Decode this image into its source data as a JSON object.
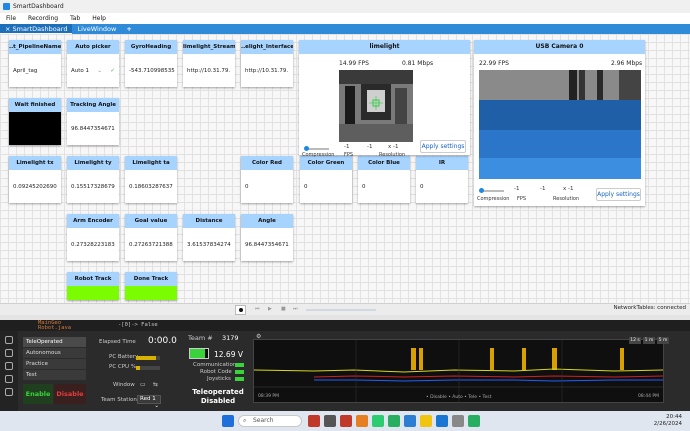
{
  "window": {
    "title": "SmartDashboard"
  },
  "menu": [
    "File",
    "Recording",
    "Tab",
    "Help"
  ],
  "tabs": [
    {
      "label": "× SmartDashboard",
      "active": true
    },
    {
      "label": "LiveWindow",
      "active": false
    }
  ],
  "tab_add": "+",
  "widgets": {
    "pipeline": {
      "title": "..t_PipelineName",
      "value": "April_tag"
    },
    "auto": {
      "title": "Auto picker",
      "value": "Auto 1"
    },
    "gyro": {
      "title": "GyroHeading",
      "value": "-543.710998535"
    },
    "ll_stream": {
      "title": "limelight_Stream",
      "value": "http://10.31.79."
    },
    "ll_iface": {
      "title": "..elight_Interface",
      "value": "http://10.31.79."
    },
    "wait": {
      "title": "Wait finished"
    },
    "tracking_angle": {
      "title": "Tracking Angle",
      "value": "96.8447354671"
    },
    "lltx": {
      "title": "Limelight tx",
      "value": "0.09245202690"
    },
    "llty": {
      "title": "Limelight ty",
      "value": "0.15517328679"
    },
    "llta": {
      "title": "Limelight ta",
      "value": "0.18603287637"
    },
    "color_red": {
      "title": "Color Red",
      "value": "0"
    },
    "color_green": {
      "title": "Color Green",
      "value": "0"
    },
    "color_blue": {
      "title": "Color Blue",
      "value": "0"
    },
    "ir": {
      "title": "IR",
      "value": "0"
    },
    "arm": {
      "title": "Arm Encoder",
      "value": "0.27328223183"
    },
    "goal": {
      "title": "Goal value",
      "value": "0.27263721388"
    },
    "distance": {
      "title": "Distance",
      "value": "3.61537834274"
    },
    "angle": {
      "title": "Angle",
      "value": "96.8447354671"
    },
    "robot_track": {
      "title": "Robot Track"
    },
    "done_track": {
      "title": "Done Track"
    }
  },
  "limelight_cam": {
    "title": "limelight",
    "fps": "14.99 FPS",
    "bitrate": "0.81 Mbps",
    "compression_val": "-1",
    "fps_val": "-1",
    "res_val": "x -1",
    "compression_label": "Compression",
    "fps_label": "FPS",
    "res_label": "Resolution",
    "apply": "Apply settings"
  },
  "usb_cam": {
    "title": "USB Camera 0",
    "fps": "22.99 FPS",
    "bitrate": "2.96 Mbps",
    "compression_val": "-1",
    "fps_val": "-1",
    "res_val": "x -1",
    "compression_label": "Compression",
    "fps_label": "FPS",
    "res_label": "Resolution",
    "apply": "Apply settings"
  },
  "status": {
    "network": "NetworkTables: connected"
  },
  "editor": {
    "line1": "MainGeo",
    "line2": "Robot.java",
    "line3": "-[0]-> False"
  },
  "ds": {
    "modes": [
      "TeleOperated",
      "Autonomous",
      "Practice",
      "Test"
    ],
    "enable": "Enable",
    "disable": "Disable",
    "elapsed_label": "Elapsed Time",
    "elapsed": "0:00.0",
    "pc_battery": "PC Battery",
    "pc_cpu": "PC CPU %",
    "window_label": "Window",
    "team_station_label": "Team Station",
    "team_station": "Red 1",
    "team_label": "Team #",
    "team": "3179",
    "voltage": "12.69 V",
    "comms": "Communications",
    "robot_code": "Robot Code",
    "joysticks": "Joysticks",
    "status_line1": "Teleoperated",
    "status_line2": "Disabled",
    "chart_time_left": "08:39 PM",
    "chart_time_right": "08:44 PM",
    "chart_legend": "• Disable  • Auto  • Tele  • Test",
    "chart_buttons": [
      "12 s",
      "1 m",
      "5 m"
    ]
  },
  "taskbar": {
    "search": "Search",
    "time": "20:44",
    "date": "2/26/2024"
  }
}
